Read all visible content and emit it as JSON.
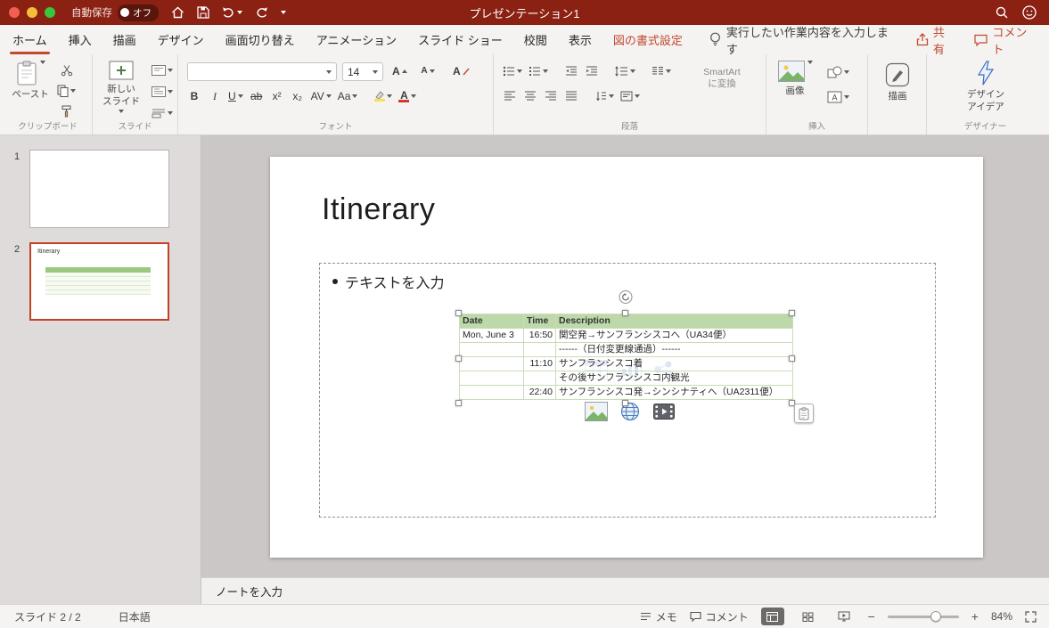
{
  "titlebar": {
    "autosave_label": "自動保存",
    "autosave_state": "オフ",
    "title": "プレゼンテーション1"
  },
  "tabs": {
    "home": "ホーム",
    "insert": "挿入",
    "draw": "描画",
    "design": "デザイン",
    "transitions": "画面切り替え",
    "animations": "アニメーション",
    "slideshow": "スライド ショー",
    "review": "校閲",
    "view": "表示",
    "shape_format": "図の書式設定",
    "tellme": "実行したい作業内容を入力します",
    "share": "共有",
    "comments": "コメント"
  },
  "ribbon": {
    "paste": "ペースト",
    "group_clipboard": "クリップボード",
    "new_slide_line1": "新しい",
    "new_slide_line2": "スライド",
    "group_slides": "スライド",
    "font_size": "14",
    "bold": "B",
    "italic": "I",
    "underline": "U",
    "strikethrough": "ab",
    "superscript": "x²",
    "subscript": "x₂",
    "spacing": "AV",
    "case": "Aa",
    "grow_font": "A",
    "shrink_font": "A",
    "clear_format": "A",
    "font_color": "A",
    "textbox_letter": "A",
    "group_font": "フォント",
    "smartart_line1": "SmartArt",
    "smartart_line2": "に変換",
    "group_paragraph": "段落",
    "picture": "画像",
    "group_insert": "挿入",
    "draw_button": "描画",
    "design_ideas_line1": "デザイン",
    "design_ideas_line2": "アイデア",
    "group_designer": "デザイナー"
  },
  "thumbnails": {
    "slide1_number": "1",
    "slide2_number": "2",
    "slide2_title": "Itinerary"
  },
  "slide": {
    "title": "Itinerary",
    "bullet_text": "テキストを入力",
    "table": {
      "headers": [
        "Date",
        "Time",
        "Description"
      ],
      "rows": [
        [
          "Mon, June 3",
          "16:50",
          "関空発→サンフランシスコへ（UA34便）"
        ],
        [
          "",
          "",
          "------（日付変更線通過）------"
        ],
        [
          "",
          "11:10",
          "サンフランシスコ着"
        ],
        [
          "",
          "",
          "その後サンフランシスコ内観光"
        ],
        [
          "",
          "22:40",
          "サンフランシスコ発→シンシナティへ（UA2311便）"
        ]
      ],
      "header_color": "#b9d7a5"
    }
  },
  "notes": {
    "placeholder": "ノートを入力"
  },
  "statusbar": {
    "slide_info": "スライド 2 / 2",
    "language": "日本語",
    "memo": "メモ",
    "comments": "コメント",
    "zoom": "84%"
  },
  "colors": {
    "titlebar_red": "#8a2113",
    "accent_red": "#c04a2f",
    "selection_orange": "#c44224",
    "table_header_green": "#b9d7a5"
  }
}
